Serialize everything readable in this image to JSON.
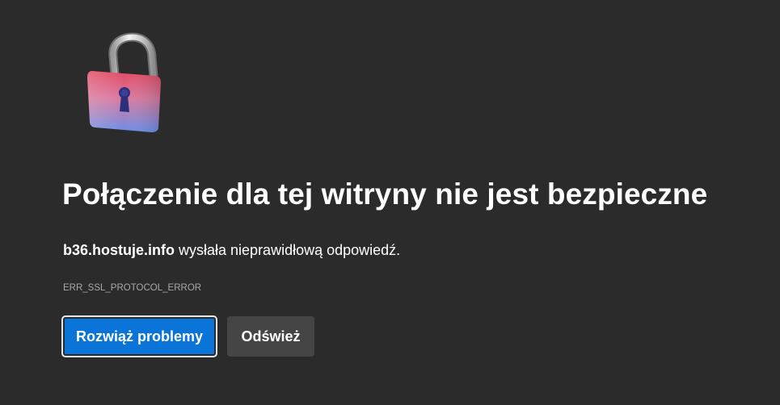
{
  "error_page": {
    "title": "Połączenie dla tej witryny nie jest bezpieczne",
    "host": "b36.hostuje.info",
    "message_rest": " wysłała nieprawidłową odpowiedź.",
    "error_code": "ERR_SSL_PROTOCOL_ERROR",
    "icon": "unlocked-padlock-icon"
  },
  "buttons": {
    "troubleshoot_label": "Rozwiąż problemy",
    "refresh_label": "Odśwież"
  },
  "colors": {
    "background": "#2b2b2b",
    "primary_button": "#0a74d8",
    "secondary_button": "#454545",
    "error_code_text": "#a8a8a8"
  }
}
